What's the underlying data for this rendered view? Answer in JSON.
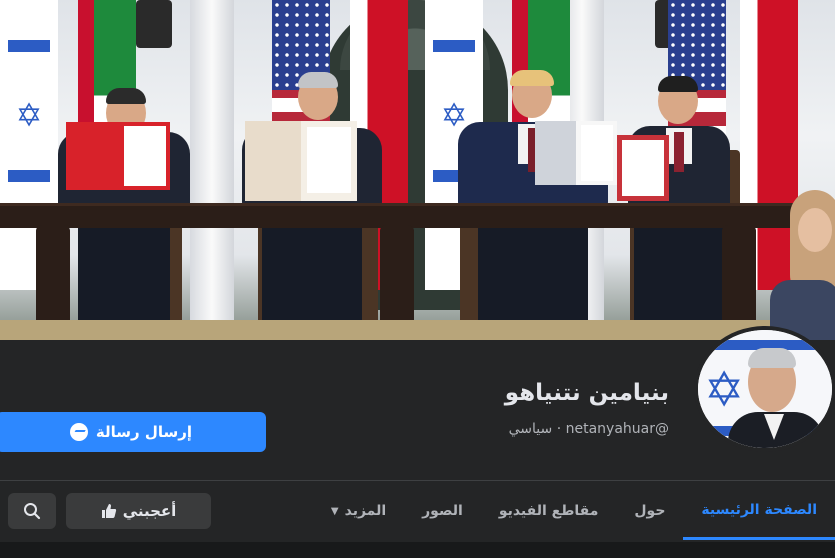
{
  "profile": {
    "name": "بنيامين نتنياهو",
    "subtitle": "@netanyahuar · سياسي"
  },
  "actions": {
    "send_message": "إرسال رسالة",
    "like": "أعجبني"
  },
  "tabs": [
    {
      "label": "الصفحة الرئيسية",
      "active": true
    },
    {
      "label": "حول",
      "active": false
    },
    {
      "label": "مقاطع الفيديو",
      "active": false
    },
    {
      "label": "الصور",
      "active": false
    },
    {
      "label": "المزيد",
      "active": false,
      "has_dropdown": true
    }
  ],
  "colors": {
    "accent": "#2d88ff",
    "background": "#242526",
    "button_secondary": "#3a3b3c"
  },
  "icons": {
    "send_message": "messenger-icon",
    "like": "thumbs-up-icon",
    "search": "search-icon",
    "more": "caret-down-icon"
  }
}
